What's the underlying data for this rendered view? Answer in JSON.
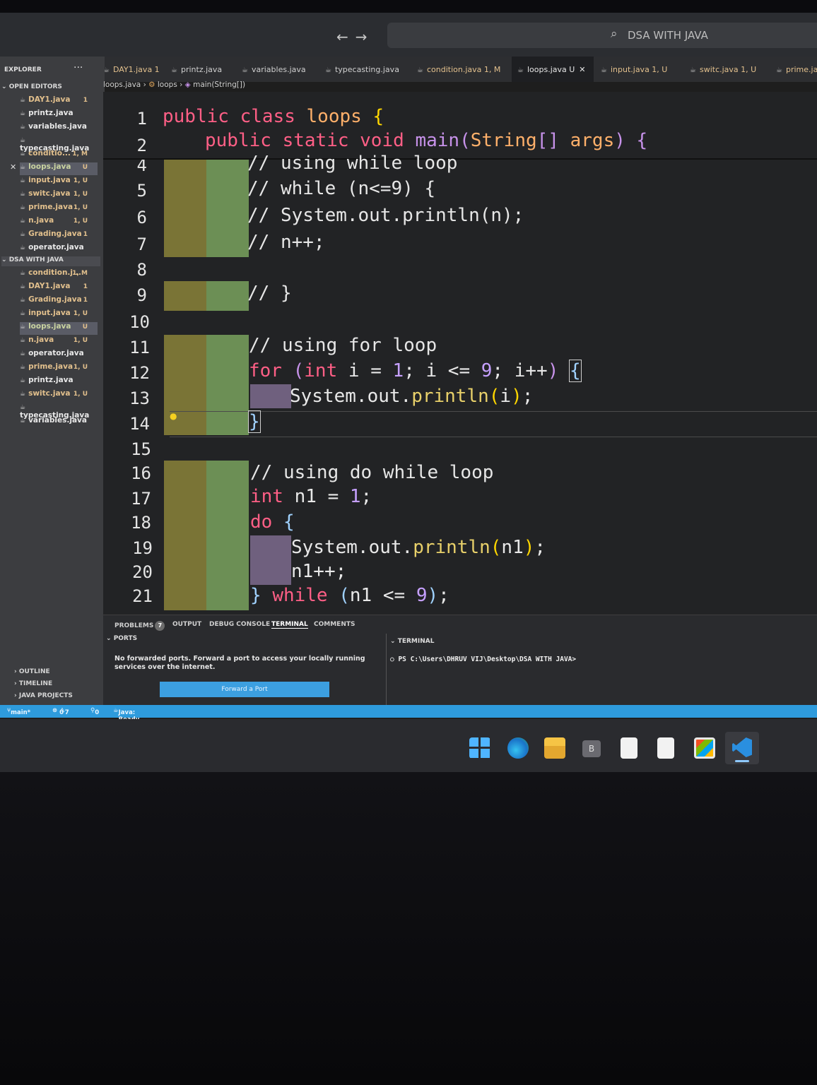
{
  "titlebar": {
    "search_text": "DSA WITH JAVA",
    "back_arrow": "←",
    "forward_arrow": "→"
  },
  "sidebar": {
    "header": "EXPLORER",
    "more": "···",
    "open_editors_label": "OPEN EDITORS",
    "open_editors": [
      {
        "name": "DAY1.java",
        "badge": "1",
        "state": "mod"
      },
      {
        "name": "printz.java",
        "badge": "",
        "state": ""
      },
      {
        "name": "variables.java",
        "badge": "",
        "state": ""
      },
      {
        "name": "typecasting.java",
        "badge": "",
        "state": ""
      },
      {
        "name": "conditio...",
        "badge": "1, M",
        "state": "mod"
      },
      {
        "name": "loops.java",
        "badge": "U",
        "state": "sel"
      },
      {
        "name": "input.java",
        "badge": "1, U",
        "state": "mod"
      },
      {
        "name": "switc.java",
        "badge": "1, U",
        "state": "mod"
      },
      {
        "name": "prime.java",
        "badge": "1, U",
        "state": "mod"
      },
      {
        "name": "n.java",
        "badge": "1, U",
        "state": "mod"
      },
      {
        "name": "Grading.java",
        "badge": "1",
        "state": "mod"
      },
      {
        "name": "operator.java",
        "badge": "",
        "state": ""
      }
    ],
    "folder_label": "DSA WITH JAVA",
    "folder_items": [
      {
        "name": "condition.j...",
        "badge": "1, M",
        "state": "mod"
      },
      {
        "name": "DAY1.java",
        "badge": "1",
        "state": "mod"
      },
      {
        "name": "Grading.java",
        "badge": "1",
        "state": "mod"
      },
      {
        "name": "input.java",
        "badge": "1, U",
        "state": "mod"
      },
      {
        "name": "loops.java",
        "badge": "U",
        "state": "sel"
      },
      {
        "name": "n.java",
        "badge": "1, U",
        "state": "mod"
      },
      {
        "name": "operator.java",
        "badge": "",
        "state": ""
      },
      {
        "name": "prime.java",
        "badge": "1, U",
        "state": "mod"
      },
      {
        "name": "printz.java",
        "badge": "",
        "state": ""
      },
      {
        "name": "switc.java",
        "badge": "1, U",
        "state": "mod"
      },
      {
        "name": "typecasting.java",
        "badge": "",
        "state": ""
      },
      {
        "name": "variables.java",
        "badge": "",
        "state": ""
      }
    ],
    "bottom_sections": [
      "OUTLINE",
      "TIMELINE",
      "JAVA PROJECTS"
    ]
  },
  "tabs": [
    {
      "label": "DAY1.java 1",
      "state": "mod"
    },
    {
      "label": "printz.java",
      "state": ""
    },
    {
      "label": "variables.java",
      "state": ""
    },
    {
      "label": "typecasting.java",
      "state": ""
    },
    {
      "label": "condition.java 1, M",
      "state": "mod"
    },
    {
      "label": "loops.java U",
      "state": "active"
    },
    {
      "label": "input.java 1, U",
      "state": "mod"
    },
    {
      "label": "switc.java 1, U",
      "state": "mod"
    },
    {
      "label": "prime.ja",
      "state": "mod"
    }
  ],
  "breadcrumb": {
    "file": "loops.java",
    "cls": "loops",
    "method": "main(String[])"
  },
  "line_numbers": [
    "1",
    "2",
    "4",
    "5",
    "6",
    "7",
    "8",
    "9",
    "10",
    "11",
    "12",
    "13",
    "14",
    "15",
    "16",
    "17",
    "18",
    "19",
    "20",
    "21"
  ],
  "panel": {
    "tabs": [
      "PROBLEMS",
      "OUTPUT",
      "DEBUG CONSOLE",
      "TERMINAL",
      "COMMENTS"
    ],
    "problems_count": "7",
    "ports_label": "PORTS",
    "ports_message": "No forwarded ports. Forward a port to access your locally running services over the internet.",
    "forward_button": "Forward a Port",
    "terminal_label": "TERMINAL",
    "terminal_prompt": "PS C:\\Users\\DHRUV VIJ\\Desktop\\DSA WITH JAVA>"
  },
  "statusbar": {
    "branch": "main*",
    "errors": "0",
    "warnings": "7",
    "ports": "0",
    "java": "Java: Ready"
  }
}
